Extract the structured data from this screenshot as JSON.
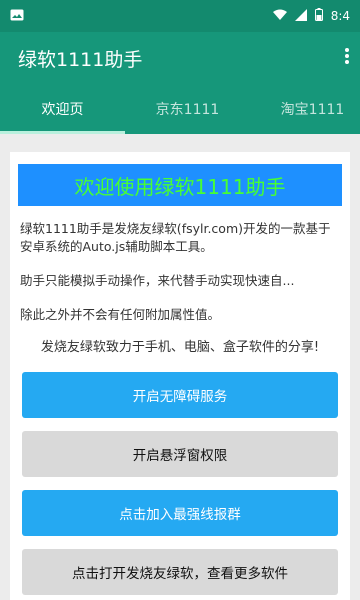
{
  "status_bar": {
    "left_icon": "image-icon",
    "time": "8:4"
  },
  "app_bar": {
    "title": "绿软1111助手",
    "menu_icon": "more-vert-icon"
  },
  "tabs": [
    {
      "label": "欢迎页",
      "active": true
    },
    {
      "label": "京东1111",
      "active": false
    },
    {
      "label": "淘宝1111",
      "active": false
    }
  ],
  "banner": {
    "text": "欢迎使用绿软1111助手"
  },
  "description": {
    "para1": "绿软1111助手是发烧友绿软(fsylr.com)开发的一款基于安卓系统的Auto.js辅助脚本工具。",
    "para2": "助手只能模拟手动操作，来代替手动实现快速自...",
    "para3": "除此之外并不会有任何附加属性值。"
  },
  "share_text": "发烧友绿软致力于手机、电脑、盒子软件的分享!",
  "buttons": {
    "accessibility": "开启无障碍服务",
    "floating": "开启悬浮窗权限",
    "join_group": "点击加入最强线报群",
    "open_site": "点击打开发烧友绿软，查看更多软件"
  },
  "colors": {
    "header": "#16977a",
    "banner_bg": "#1e90ff",
    "banner_text": "#47ff33",
    "button_blue": "#25a9f2",
    "button_gray": "#d9d9d9"
  }
}
